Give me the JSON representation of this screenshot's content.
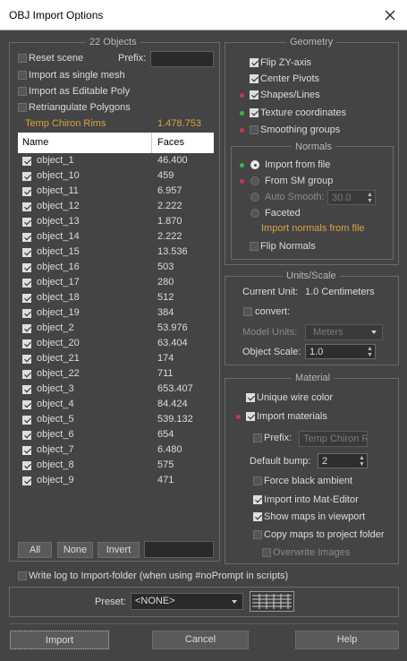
{
  "window": {
    "title": "OBJ Import Options"
  },
  "objects_panel": {
    "title": "22 Objects",
    "reset_scene": "Reset scene",
    "prefix_label": "Prefix:",
    "import_single_mesh": "Import as single mesh",
    "import_editable_poly": "Import as Editable Poly",
    "retriangulate": "Retriangulate Polygons",
    "summary_name": "Temp Chiron Rims",
    "summary_faces": "1.478.753",
    "columns": {
      "name": "Name",
      "faces": "Faces"
    },
    "rows": [
      {
        "name": "object_1",
        "faces": "46.400",
        "checked": true
      },
      {
        "name": "object_10",
        "faces": "459",
        "checked": true
      },
      {
        "name": "object_11",
        "faces": "6.957",
        "checked": true
      },
      {
        "name": "object_12",
        "faces": "2.222",
        "checked": true
      },
      {
        "name": "object_13",
        "faces": "1.870",
        "checked": true
      },
      {
        "name": "object_14",
        "faces": "2.222",
        "checked": true
      },
      {
        "name": "object_15",
        "faces": "13.536",
        "checked": true
      },
      {
        "name": "object_16",
        "faces": "503",
        "checked": true
      },
      {
        "name": "object_17",
        "faces": "280",
        "checked": true
      },
      {
        "name": "object_18",
        "faces": "512",
        "checked": true
      },
      {
        "name": "object_19",
        "faces": "384",
        "checked": true
      },
      {
        "name": "object_2",
        "faces": "53.976",
        "checked": true
      },
      {
        "name": "object_20",
        "faces": "63.404",
        "checked": true
      },
      {
        "name": "object_21",
        "faces": "174",
        "checked": true
      },
      {
        "name": "object_22",
        "faces": "711",
        "checked": true
      },
      {
        "name": "object_3",
        "faces": "653.407",
        "checked": true
      },
      {
        "name": "object_4",
        "faces": "84.424",
        "checked": true
      },
      {
        "name": "object_5",
        "faces": "539.132",
        "checked": true
      },
      {
        "name": "object_6",
        "faces": "654",
        "checked": true
      },
      {
        "name": "object_7",
        "faces": "6.480",
        "checked": true
      },
      {
        "name": "object_8",
        "faces": "575",
        "checked": true
      },
      {
        "name": "object_9",
        "faces": "471",
        "checked": true
      }
    ],
    "buttons": {
      "all": "All",
      "none": "None",
      "invert": "Invert"
    }
  },
  "geometry": {
    "title": "Geometry",
    "flip_zy": "Flip ZY-axis",
    "center_pivots": "Center Pivots",
    "shapes_lines": "Shapes/Lines",
    "texture_coords": "Texture coordinates",
    "smoothing_groups": "Smoothing groups",
    "normals_title": "Normals",
    "import_from_file": "Import from file",
    "from_sm_group": "From SM group",
    "auto_smooth": "Auto Smooth:",
    "auto_smooth_value": "30.0",
    "faceted": "Faceted",
    "normals_note": "Import normals from file",
    "flip_normals": "Flip Normals"
  },
  "units": {
    "title": "Units/Scale",
    "current_unit_label": "Current Unit:",
    "current_unit_value": "1.0 Centimeters",
    "convert": "convert:",
    "model_units_label": "Model Units:",
    "model_units_value": "Meters",
    "object_scale_label": "Object Scale:",
    "object_scale_value": "1.0"
  },
  "material": {
    "title": "Material",
    "unique_wire_color": "Unique wire color",
    "import_materials": "Import materials",
    "prefix_label": "Prefix:",
    "prefix_value": "Temp Chiron Rir",
    "default_bump_label": "Default bump:",
    "default_bump_value": "2",
    "force_black_ambient": "Force black ambient",
    "import_mat_editor": "Import into Mat-Editor",
    "show_maps": "Show maps in viewport",
    "copy_maps": "Copy maps to project folder",
    "overwrite_images": "Overwrite Images"
  },
  "write_log": "Write log to Import-folder (when using #noPrompt in scripts)",
  "preset": {
    "label": "Preset:",
    "value": "<NONE>"
  },
  "footer": {
    "import": "Import",
    "cancel": "Cancel",
    "help": "Help"
  },
  "colors": {
    "dot_red": "#c8364a",
    "dot_green": "#3fb34f",
    "accent_orange": "#d9a441"
  }
}
